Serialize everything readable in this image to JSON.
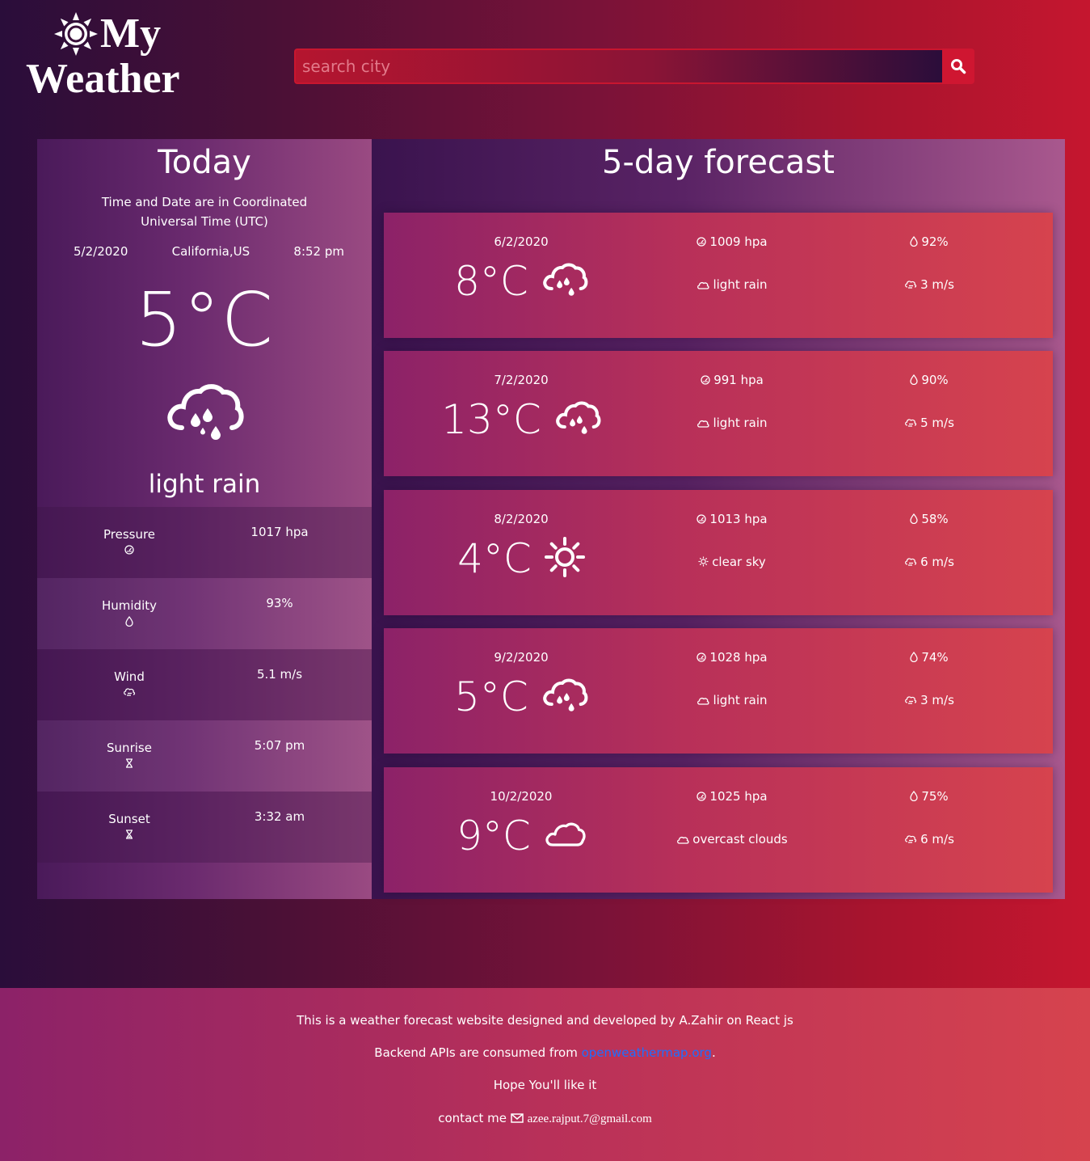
{
  "header": {
    "logo_line1": "My",
    "logo_line2": "Weather",
    "search_placeholder": "search city"
  },
  "today": {
    "title": "Today",
    "utc_note": "Time and Date are in Coordinated Universal Time (UTC)",
    "date": "5/2/2020",
    "location": "California,US",
    "time": "8:52 pm",
    "temperature": "5°C",
    "icon": "rain-cloud-icon",
    "description": "light rain",
    "stats": [
      {
        "label": "Pressure",
        "value": "1017 hpa",
        "icon": "gauge-icon"
      },
      {
        "label": "Humidity",
        "value": "93%",
        "icon": "droplet-icon"
      },
      {
        "label": "Wind",
        "value": "5.1 m/s",
        "icon": "wind-cloud-icon"
      },
      {
        "label": "Sunrise",
        "value": "5:07 pm",
        "icon": "hourglass-icon"
      },
      {
        "label": "Sunset",
        "value": "3:32 am",
        "icon": "hourglass-icon"
      }
    ]
  },
  "forecast": {
    "title": "5-day forecast",
    "days": [
      {
        "date": "6/2/2020",
        "temp": "8°C",
        "icon": "rain-cloud-icon",
        "pressure": "1009 hpa",
        "description": "light rain",
        "desc_icon": "cloud-icon",
        "humidity": "92%",
        "wind": "3 m/s"
      },
      {
        "date": "7/2/2020",
        "temp": "13°C",
        "icon": "rain-cloud-icon",
        "pressure": "991 hpa",
        "description": "light rain",
        "desc_icon": "cloud-icon",
        "humidity": "90%",
        "wind": "5 m/s"
      },
      {
        "date": "8/2/2020",
        "temp": "4°C",
        "icon": "sun-icon",
        "pressure": "1013 hpa",
        "description": "clear sky",
        "desc_icon": "sun-icon",
        "humidity": "58%",
        "wind": "6 m/s"
      },
      {
        "date": "9/2/2020",
        "temp": "5°C",
        "icon": "rain-cloud-icon",
        "pressure": "1028 hpa",
        "description": "light rain",
        "desc_icon": "cloud-icon",
        "humidity": "74%",
        "wind": "3 m/s"
      },
      {
        "date": "10/2/2020",
        "temp": "9°C",
        "icon": "cloud-icon",
        "pressure": "1025 hpa",
        "description": "overcast clouds",
        "desc_icon": "cloud-icon",
        "humidity": "75%",
        "wind": "6 m/s"
      }
    ]
  },
  "footer": {
    "line1": "This is a weather forecast website designed and developed by A.Zahir on React js",
    "line2_prefix": "Backend APIs are consumed from ",
    "line2_link": "openweathermap.org",
    "line2_suffix": ".",
    "line3": "Hope You'll like it",
    "contact_label": "contact me",
    "email": "azee.rajput.7@gmail.com"
  },
  "colors": {
    "accent": "#cf1631",
    "link": "#1e6fff"
  }
}
